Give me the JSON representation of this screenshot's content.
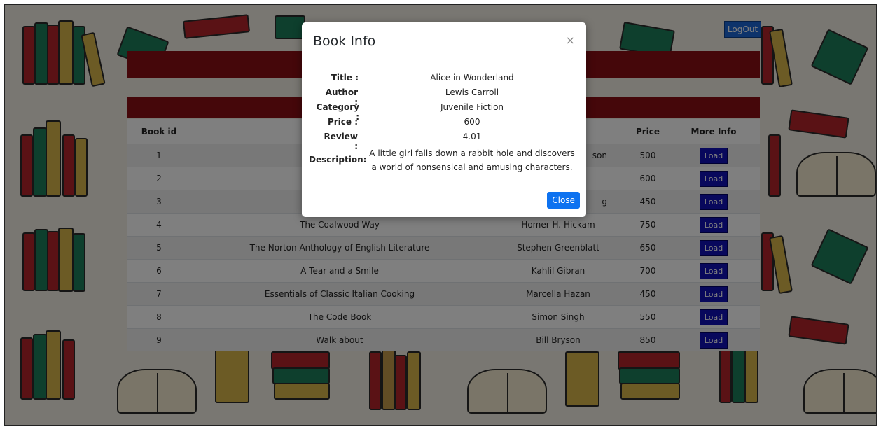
{
  "header": {
    "logout_label": "LogOut"
  },
  "table": {
    "headers": [
      "Book id",
      "",
      "",
      "Price",
      "More Info"
    ],
    "rows": [
      {
        "id": "1",
        "title": "",
        "author": "son",
        "price": "500",
        "action": "Load"
      },
      {
        "id": "2",
        "title": "",
        "author": "",
        "price": "600",
        "action": "Load"
      },
      {
        "id": "3",
        "title": "",
        "author": "g",
        "price": "450",
        "action": "Load"
      },
      {
        "id": "4",
        "title": "The Coalwood Way",
        "author": "Homer H. Hickam",
        "price": "750",
        "action": "Load"
      },
      {
        "id": "5",
        "title": "The Norton Anthology of English Literature",
        "author": "Stephen Greenblatt",
        "price": "650",
        "action": "Load"
      },
      {
        "id": "6",
        "title": "A Tear and a Smile",
        "author": "Kahlil Gibran",
        "price": "700",
        "action": "Load"
      },
      {
        "id": "7",
        "title": "Essentials of Classic Italian Cooking",
        "author": "Marcella Hazan",
        "price": "450",
        "action": "Load"
      },
      {
        "id": "8",
        "title": "The Code Book",
        "author": "Simon Singh",
        "price": "550",
        "action": "Load"
      },
      {
        "id": "9",
        "title": "Walk about",
        "author": "Bill Bryson",
        "price": "850",
        "action": "Load"
      }
    ]
  },
  "modal": {
    "title": "Book Info",
    "close_x": "×",
    "fields": [
      {
        "label": "Title :",
        "value": "Alice in Wonderland"
      },
      {
        "label": "Author :",
        "value": "Lewis Carroll"
      },
      {
        "label": "Category :",
        "value": "Juvenile Fiction"
      },
      {
        "label": "Price :",
        "value": "600"
      },
      {
        "label": "Review :",
        "value": "4.01"
      },
      {
        "label": "Description:",
        "value": "A little girl falls down a rabbit hole and discovers a world of nonsensical and amusing characters."
      }
    ],
    "close_button_label": "Close"
  },
  "colors": {
    "header_bar": "#8b0f14",
    "load_button": "#1010b8",
    "close_button": "#0d72f0",
    "logout_button": "#1b66d6"
  }
}
